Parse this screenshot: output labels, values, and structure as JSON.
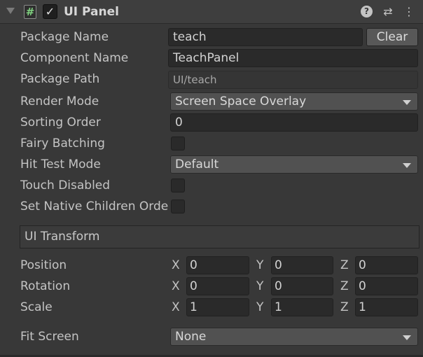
{
  "component": {
    "title": "UI Panel",
    "script_icon_glyph": "#",
    "enabled_glyph": "✓",
    "help_glyph": "?",
    "presets_glyph": "⇄",
    "menu_glyph": "⋮"
  },
  "fields": {
    "package_name": {
      "label": "Package Name",
      "value": "teach",
      "button": "Clear"
    },
    "component_name": {
      "label": "Component Name",
      "value": "TeachPanel"
    },
    "package_path": {
      "label": "Package Path",
      "value": "UI/teach"
    },
    "render_mode": {
      "label": "Render Mode",
      "value": "Screen Space Overlay"
    },
    "sorting_order": {
      "label": "Sorting Order",
      "value": "0"
    },
    "fairy_batching": {
      "label": "Fairy Batching",
      "checked": false
    },
    "hit_test_mode": {
      "label": "Hit Test Mode",
      "value": "Default"
    },
    "touch_disabled": {
      "label": "Touch Disabled",
      "checked": false
    },
    "set_native_children_order": {
      "label": "Set Native Children Orde",
      "checked": false
    }
  },
  "transform": {
    "title": "UI Transform",
    "axis_labels": {
      "x": "X",
      "y": "Y",
      "z": "Z"
    },
    "position": {
      "label": "Position",
      "x": "0",
      "y": "0",
      "z": "0"
    },
    "rotation": {
      "label": "Rotation",
      "x": "0",
      "y": "0",
      "z": "0"
    },
    "scale": {
      "label": "Scale",
      "x": "1",
      "y": "1",
      "z": "1"
    }
  },
  "fit_screen": {
    "label": "Fit Screen",
    "value": "None"
  }
}
